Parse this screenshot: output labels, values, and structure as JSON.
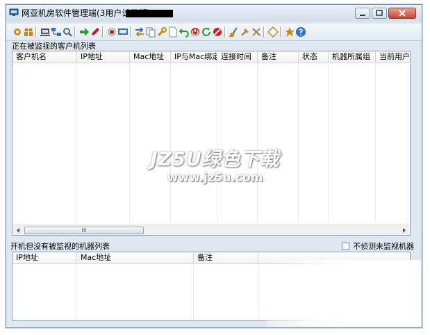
{
  "window": {
    "title": "网亚机房软件管理端(3用户试用版)"
  },
  "toolbar": {
    "buttons": [
      {
        "icon": "gear-icon",
        "color": "#c98a1a"
      },
      {
        "icon": "users-icon",
        "color": "#d0801a"
      },
      {
        "icon": "computer-icon",
        "color": "#555555"
      },
      {
        "icon": "network-icon",
        "color": "#3a6fb0"
      },
      {
        "icon": "search-icon",
        "color": "#3a6fb0"
      },
      {
        "icon": "arrow-right-icon",
        "color": "#2e9a2e"
      },
      {
        "icon": "pencil-icon",
        "color": "#c02020"
      },
      {
        "icon": "record-icon",
        "color": "#b02020"
      },
      {
        "icon": "monitor-icon",
        "color": "#3a6fb0"
      },
      {
        "icon": "transfer-icon",
        "color": "#3a6fb0"
      },
      {
        "icon": "copy-icon",
        "color": "#6a7a8a"
      },
      {
        "icon": "wrench-icon",
        "color": "#c98a1a"
      },
      {
        "icon": "document-icon",
        "color": "#8a8a8a"
      },
      {
        "icon": "undo-icon",
        "color": "#2e9a2e"
      },
      {
        "icon": "power-icon",
        "color": "#d03020"
      },
      {
        "icon": "refresh-icon",
        "color": "#2e9a2e"
      },
      {
        "icon": "stop-icon",
        "color": "#d02020"
      },
      {
        "icon": "broom-icon",
        "color": "#3a6fb0"
      },
      {
        "icon": "pin-icon",
        "color": "#c98a1a"
      },
      {
        "icon": "tools-icon",
        "color": "#c98a1a"
      },
      {
        "icon": "diamond-icon",
        "color": "#d08020"
      },
      {
        "icon": "star-icon",
        "color": "#c98a1a"
      },
      {
        "icon": "help-icon",
        "color": "#2f6fd0"
      }
    ]
  },
  "monitored": {
    "label": "正在被监视的客户机列表",
    "columns": [
      "客户机名",
      "IP地址",
      "Mac地址",
      "IP与Mac绑定",
      "连接时间",
      "备注",
      "状态",
      "机器所属组",
      "当前用户"
    ],
    "scrollbar_thumb": "III"
  },
  "unmonitored": {
    "label": "开机但没有被监视的机器列表",
    "checkbox_label": "不侦测未监视机器",
    "checkbox_checked": false,
    "columns": [
      "IP地址",
      "Mac地址",
      "备注"
    ]
  },
  "watermark": {
    "line1": "JZ5U绿色下载",
    "line2": "www.jz5u.com"
  }
}
